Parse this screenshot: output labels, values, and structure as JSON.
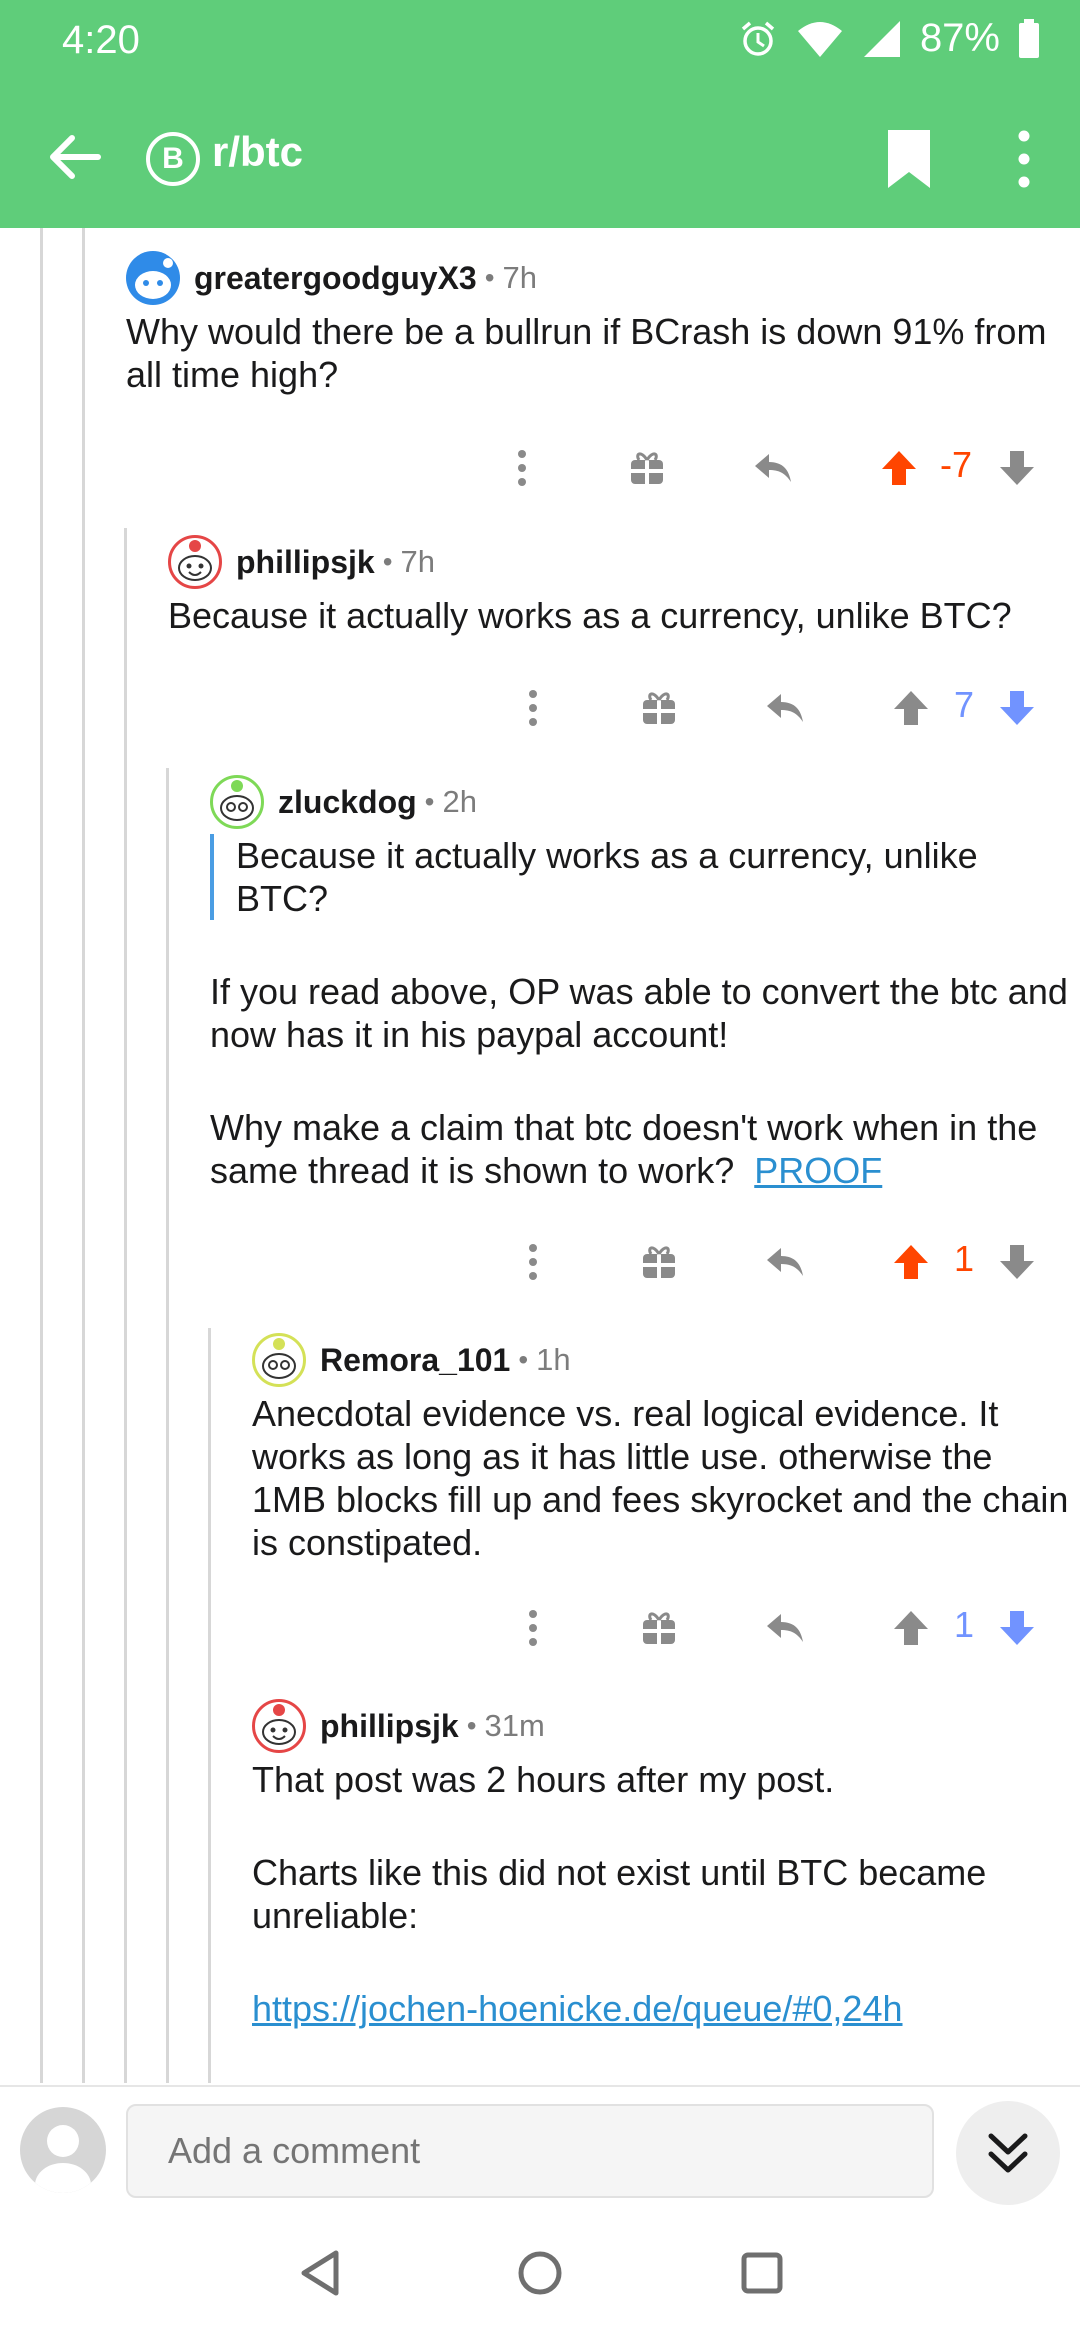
{
  "status_bar": {
    "time": "4:20",
    "battery": "87%"
  },
  "app_bar": {
    "subreddit": "r/btc",
    "sub_icon_glyph": "B"
  },
  "comments": [
    {
      "author": "greatergoodguyX3",
      "age": "7h",
      "paragraphs": [
        "Why would there be a bullrun if BCrash is down 91% from all time high?"
      ],
      "score": "-7",
      "vote": "up"
    },
    {
      "author": "phillipsjk",
      "age": "7h",
      "paragraphs": [
        "Because it actually works as a currency, unlike BTC?"
      ],
      "score": "7",
      "vote": "down"
    },
    {
      "author": "zluckdog",
      "age": "2h",
      "quote": "Because it actually works as a currency, unlike BTC?",
      "paragraphs": [
        "If you read above, OP was able to convert the btc and now has it in his paypal account!",
        "Why make a claim that btc doesn't work when in the same thread it is shown to work?"
      ],
      "link": "PROOF",
      "score": "1",
      "vote": "up"
    },
    {
      "author": "Remora_101",
      "age": "1h",
      "paragraphs": [
        "Anecdotal evidence vs. real logical evidence. It works as long as it has little use. otherwise the 1MB blocks fill up and fees skyrocket and the chain is constipated."
      ],
      "score": "1",
      "vote": "down"
    },
    {
      "author": "phillipsjk",
      "age": "31m",
      "paragraphs": [
        "That post was 2 hours after my post.",
        "Charts like this did not exist until BTC became unreliable:"
      ],
      "link": "https://jochen-hoenicke.de/queue/#0,24h"
    }
  ],
  "composer": {
    "placeholder": "Add a comment"
  },
  "colors": {
    "app_green": "#5fcd7a",
    "upvote": "#ff4500",
    "downvote": "#7193ff",
    "link": "#2a8fd0"
  },
  "icons": [
    "back-arrow-icon",
    "bitcoin-icon",
    "bookmark-icon",
    "more-vert-icon",
    "more-icon",
    "gift-icon",
    "reply-icon",
    "upvote-icon",
    "downvote-icon",
    "double-chevron-down-icon"
  ]
}
